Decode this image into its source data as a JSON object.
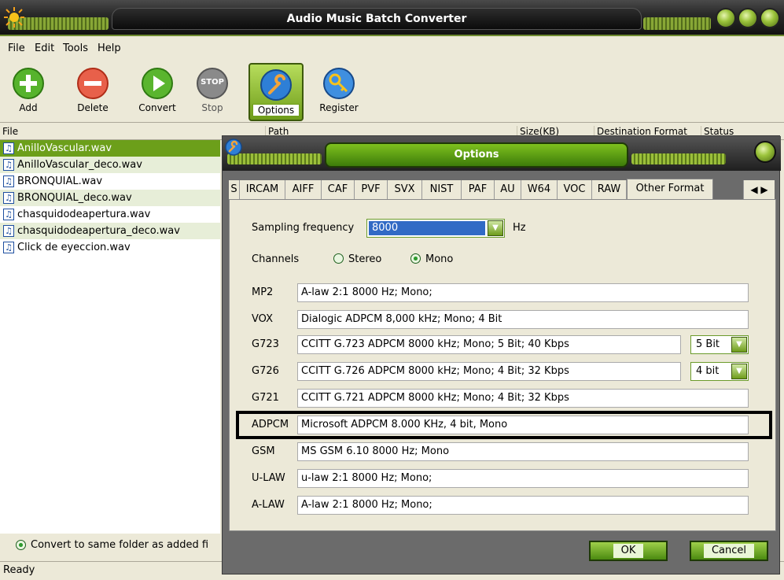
{
  "window": {
    "title": "Audio Music Batch Converter"
  },
  "menu": [
    "File",
    "Edit",
    "Tools",
    "Help"
  ],
  "toolbar": {
    "add": "Add",
    "delete": "Delete",
    "convert": "Convert",
    "stop": "Stop",
    "stop_badge": "STOP",
    "options": "Options",
    "register": "Register"
  },
  "columns": [
    "File",
    "Path",
    "Size(KB)",
    "Destination Format",
    "Status"
  ],
  "files": [
    "AnilloVascular.wav",
    "AnilloVascular_deco.wav",
    "BRONQUIAL.wav",
    "BRONQUIAL_deco.wav",
    "chasquidodeapertura.wav",
    "chasquidodeapertura_deco.wav",
    "Click de eyeccion.wav"
  ],
  "convert_same_folder": "Convert to same folder as added fi",
  "status": "Ready",
  "dialog": {
    "title": "Options",
    "tabs": [
      "S",
      "IRCAM",
      "AIFF",
      "CAF",
      "PVF",
      "SVX",
      "NIST",
      "PAF",
      "AU",
      "W64",
      "VOC",
      "RAW",
      "Other Format"
    ],
    "tab_arrows": "◀ ▶",
    "sampling_label": "Sampling frequency",
    "sampling_value": "8000",
    "sampling_unit": "Hz",
    "channels_label": "Channels",
    "stereo": "Stereo",
    "mono": "Mono",
    "formats": [
      {
        "name": "MP2",
        "desc": "A-law 2:1  8000 Hz; Mono;"
      },
      {
        "name": "VOX",
        "desc": "Dialogic ADPCM 8,000 kHz; Mono; 4 Bit"
      },
      {
        "name": "G723",
        "desc": "CCITT G.723 ADPCM 8000 kHz; Mono; 5 Bit; 40 Kbps"
      },
      {
        "name": "G726",
        "desc": "CCITT G.726 ADPCM 8000 kHz; Mono; 4 Bit; 32 Kbps"
      },
      {
        "name": "G721",
        "desc": "CCITT G.721 ADPCM 8000 kHz; Mono; 4 Bit; 32 Kbps"
      },
      {
        "name": "ADPCM",
        "desc": "Microsoft ADPCM 8.000 KHz, 4 bit, Mono"
      },
      {
        "name": "GSM",
        "desc": "MS GSM 6.10  8000 Hz; Mono"
      },
      {
        "name": "U-LAW",
        "desc": "u-law 2:1  8000 Hz; Mono;"
      },
      {
        "name": "A-LAW",
        "desc": "A-law 2:1  8000 Hz; Mono;"
      }
    ],
    "g723_bits": "5 Bit",
    "g726_bits": "4 bit",
    "ok": "OK",
    "cancel": "Cancel"
  },
  "colors": {
    "accent_green": "#6c9f1a",
    "selection_blue": "#316ac5",
    "dialog_gray": "#6b6b6b"
  }
}
